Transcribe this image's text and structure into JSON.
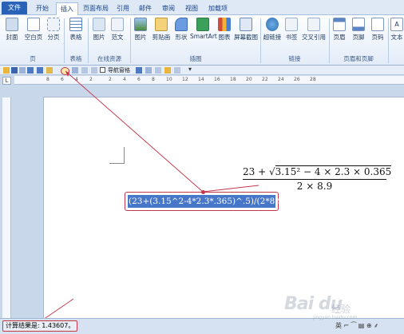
{
  "tabs": [
    "文件",
    "开始",
    "插入",
    "页面布局",
    "引用",
    "邮件",
    "审阅",
    "视图",
    "加载项"
  ],
  "ribbon": {
    "buttons": [
      "封面",
      "空白页",
      "分页",
      "表格",
      "图片",
      "剪贴画",
      "形状",
      "SmartArt",
      "图表",
      "屏幕截图",
      "超链接",
      "书签",
      "交叉引用",
      "页眉",
      "页脚",
      "页码",
      "文本"
    ],
    "groups": [
      "页",
      "表格",
      "插图",
      "链接",
      "页眉和页脚"
    ],
    "online": {
      "label1": "图片",
      "label2": "范文",
      "group": "在线资源"
    }
  },
  "qat": {
    "nav_label": "导航窗格"
  },
  "ruler": {
    "corner": "L",
    "numbers": [
      "8",
      "6",
      "4",
      "2",
      "2",
      "4",
      "6",
      "8",
      "10",
      "12",
      "14",
      "16",
      "18",
      "20",
      "22",
      "24",
      "26",
      "28"
    ]
  },
  "document": {
    "expression": "(23+(3.15^2-4*2.3*.365)^.5)/(2*8.9)",
    "formula_numerator_a": "23 + ",
    "formula_radical": "√",
    "formula_radicand": "3.15² − 4 × 2.3 × 0.365",
    "formula_denominator": "2 × 8.9"
  },
  "status": {
    "calc_result": "计算结果是: 1.43607。",
    "icons_text": "英 ⌐ ⁀ ▤ ⊕ ⸙"
  },
  "watermark": {
    "brand": "Bai du",
    "sub": "经验",
    "url": "jingyan.baidu.com"
  },
  "colors": {
    "accent": "#c4364a",
    "selection": "#4677c8",
    "file_tab": "#2a62b8"
  }
}
